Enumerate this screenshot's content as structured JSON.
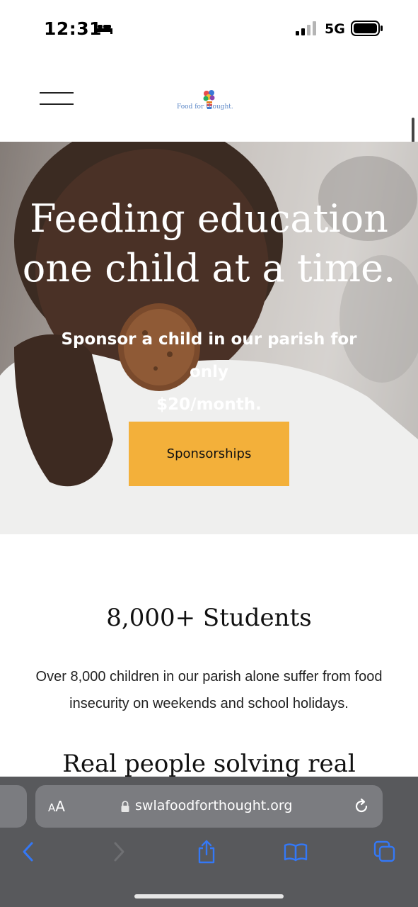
{
  "status_bar": {
    "time": "12:31",
    "network": "5G",
    "icons": [
      "bed-icon",
      "signal-icon",
      "battery-icon"
    ]
  },
  "header": {
    "menu_icon": "hamburger-menu-icon",
    "logo_text": "Food for  thought."
  },
  "hero": {
    "title_line1": "Feeding education",
    "title_line2": "one child at a time.",
    "subtitle_line1": "Sponsor a child in our parish for only",
    "subtitle_line2": "$20/month.",
    "button_label": "Sponsorships",
    "button_color": "#f3b03a"
  },
  "stats": {
    "heading": "8,000+ Students",
    "body_line1": "Over 8,000 children in our parish alone suffer from food",
    "body_line2": "insecurity on weekends and school holidays."
  },
  "next_section": {
    "heading_partial": "Real people solving real"
  },
  "browser": {
    "aa_label_small": "A",
    "aa_label_large": "A",
    "url": "swlafoodforthought.org",
    "toolbar_icons": [
      "back-icon",
      "forward-icon",
      "share-icon",
      "bookmarks-icon",
      "tabs-icon"
    ],
    "accent_color": "#3478f6"
  }
}
